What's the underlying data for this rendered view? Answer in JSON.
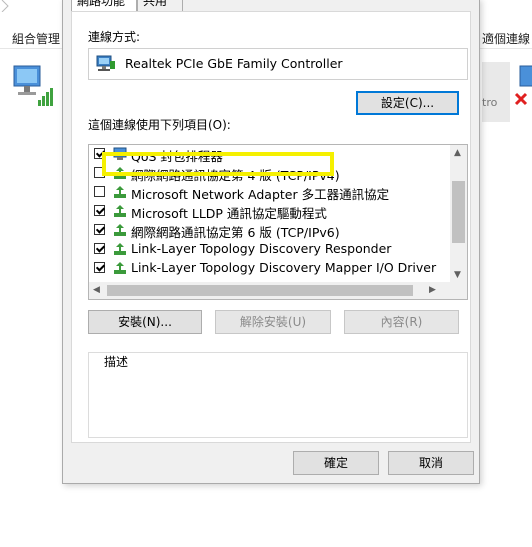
{
  "background": {
    "left_label": "組合管理",
    "right_label": "適個連線",
    "selected_item_text": "tro"
  },
  "dialog": {
    "tabs": [
      {
        "label": "網路功能"
      },
      {
        "label": "共用"
      }
    ],
    "connect_using_label": "連線方式:",
    "adapter_name": "Realtek PCIe GbE Family Controller",
    "configure_button": "設定(C)...",
    "items_label": "這個連線使用下列項目(O):",
    "items": [
      {
        "label": "QoS 封包排程器",
        "checked": true,
        "icon": "qos-icon"
      },
      {
        "label": "網際網路通訊協定第 4 版 (TCP/IPv4)",
        "checked": false,
        "icon": "protocol-icon"
      },
      {
        "label": "Microsoft Network Adapter 多工器通訊協定",
        "checked": false,
        "icon": "protocol-icon"
      },
      {
        "label": "Microsoft LLDP 通訊協定驅動程式",
        "checked": true,
        "icon": "protocol-icon"
      },
      {
        "label": "網際網路通訊協定第 6 版 (TCP/IPv6)",
        "checked": true,
        "icon": "protocol-icon"
      },
      {
        "label": "Link-Layer Topology Discovery Responder",
        "checked": true,
        "icon": "protocol-icon"
      },
      {
        "label": "Link-Layer Topology Discovery Mapper I/O Driver",
        "checked": true,
        "icon": "protocol-icon"
      }
    ],
    "install_button": "安裝(N)...",
    "uninstall_button": "解除安裝(U)",
    "properties_button": "內容(R)",
    "description_label": "描述",
    "ok_button": "確定",
    "cancel_button": "取消",
    "highlight_color": "#f5f000"
  }
}
